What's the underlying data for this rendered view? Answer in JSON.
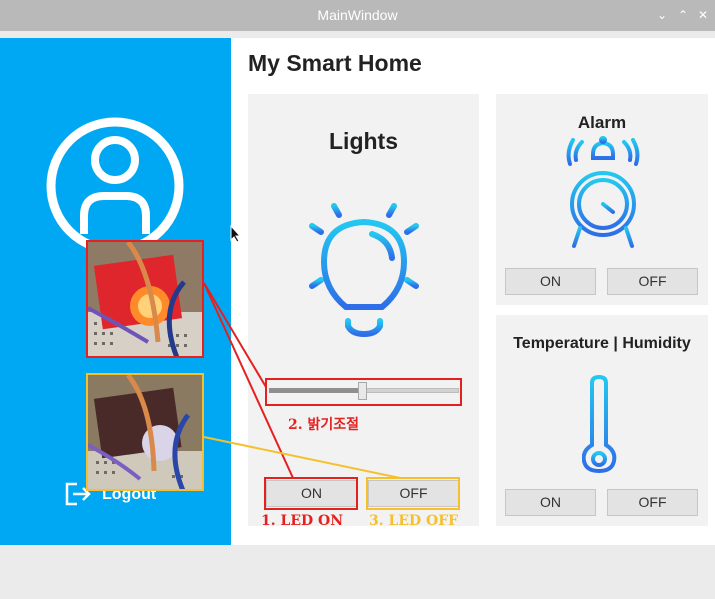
{
  "window": {
    "title": "MainWindow"
  },
  "sidebar": {
    "logout_label": "Logout"
  },
  "main": {
    "title": "My Smart Home"
  },
  "lights": {
    "title": "Lights",
    "slider_value": 0.49,
    "on_label": "ON",
    "off_label": "OFF"
  },
  "alarm": {
    "title": "Alarm",
    "on_label": "ON",
    "off_label": "OFF"
  },
  "temp": {
    "title": "Temperature | Humidity",
    "on_label": "ON",
    "off_label": "OFF"
  },
  "annotations": {
    "brightness": "2. 밝기조절",
    "led_on": "1. LED ON",
    "led_off": "3. LED OFF"
  },
  "colors": {
    "sidebar": "#00a8f3",
    "annot_red": "#e52120",
    "annot_yellow": "#f5c02c",
    "icon_blue_top": "#23c8f0",
    "icon_blue_bottom": "#2e6ee8"
  }
}
